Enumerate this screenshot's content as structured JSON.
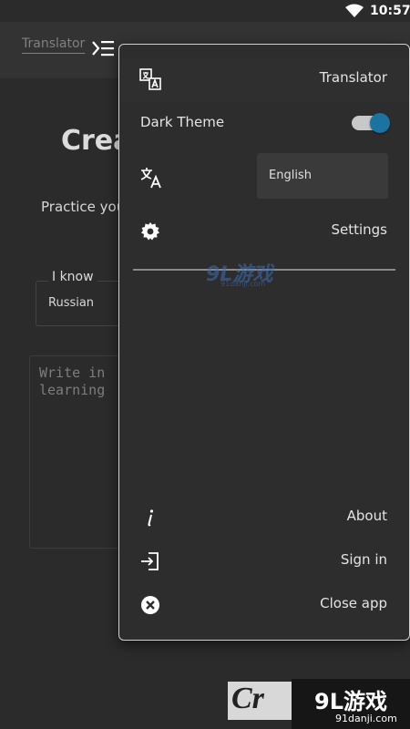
{
  "status_bar": {
    "time": "10:57"
  },
  "toolbar": {
    "app_title": "Translator"
  },
  "background": {
    "heading": "Crea",
    "subtitle": "Practice you",
    "know_label": "I know",
    "know_value": "Russian",
    "input_placeholder": "Write in\nlearning"
  },
  "drawer": {
    "header_label": "Translator",
    "dark_theme_label": "Dark Theme",
    "dark_theme_on": true,
    "language_value": "English",
    "settings_label": "Settings",
    "about_label": "About",
    "sign_in_label": "Sign in",
    "close_label": "Close app"
  },
  "watermark": {
    "center_big": "9L游戏",
    "center_small": "91danji.com",
    "corner_left": "Cr",
    "corner_big": "9L游戏",
    "corner_small": "91danji.com"
  },
  "colors": {
    "accent": "#1a73a0",
    "background": "#2b2b2b",
    "drawer": "#2d2d2d"
  }
}
